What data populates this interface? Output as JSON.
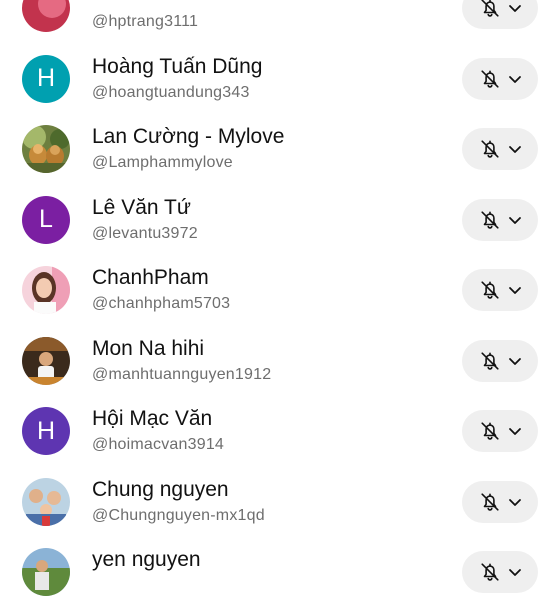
{
  "subscriptions": [
    {
      "name": "",
      "handle": "@hptrang3111",
      "avatar": {
        "type": "photo",
        "photo": "pink",
        "color": "#c2334d"
      },
      "notification_icon": "bell-off-icon",
      "menu_icon": "chevron-down-icon"
    },
    {
      "name": "Hoàng Tuấn Dũng",
      "handle": "@hoangtuandung343",
      "avatar": {
        "type": "initial",
        "letter": "H",
        "color": "#00a0b0"
      },
      "notification_icon": "bell-off-icon",
      "menu_icon": "chevron-down-icon"
    },
    {
      "name": "Lan Cường - Mylove",
      "handle": "@Lamphammylove",
      "avatar": {
        "type": "photo",
        "photo": "nature",
        "color": "#7a8a4a"
      },
      "notification_icon": "bell-off-icon",
      "menu_icon": "chevron-down-icon"
    },
    {
      "name": "Lê Văn Tứ",
      "handle": "@levantu3972",
      "avatar": {
        "type": "initial",
        "letter": "L",
        "color": "#7b1fa2"
      },
      "notification_icon": "bell-off-icon",
      "menu_icon": "chevron-down-icon"
    },
    {
      "name": "ChanhPham",
      "handle": "@chanhpham5703",
      "avatar": {
        "type": "photo",
        "photo": "portrait",
        "color": "#f2b6c6"
      },
      "notification_icon": "bell-off-icon",
      "menu_icon": "chevron-down-icon"
    },
    {
      "name": "Mon Na hihi",
      "handle": "@manhtuannguyen1912",
      "avatar": {
        "type": "photo",
        "photo": "man",
        "color": "#c98a3a"
      },
      "notification_icon": "bell-off-icon",
      "menu_icon": "chevron-down-icon"
    },
    {
      "name": "Hội Mạc Văn",
      "handle": "@hoimacvan3914",
      "avatar": {
        "type": "initial",
        "letter": "H",
        "color": "#5e35b1"
      },
      "notification_icon": "bell-off-icon",
      "menu_icon": "chevron-down-icon"
    },
    {
      "name": "Chung nguyen",
      "handle": "@Chungnguyen-mx1qd",
      "avatar": {
        "type": "photo",
        "photo": "family",
        "color": "#a7c4d8"
      },
      "notification_icon": "bell-off-icon",
      "menu_icon": "chevron-down-icon"
    },
    {
      "name": "yen nguyen",
      "handle": "",
      "avatar": {
        "type": "photo",
        "photo": "outdoor",
        "color": "#5f8a3c"
      },
      "notification_icon": "bell-off-icon",
      "menu_icon": "chevron-down-icon"
    }
  ]
}
